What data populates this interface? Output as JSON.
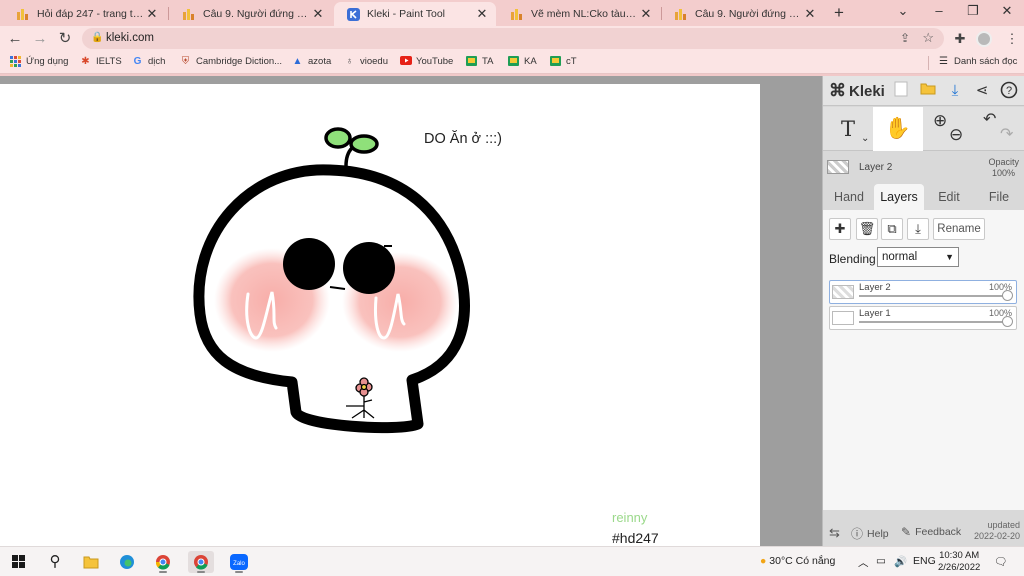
{
  "browser": {
    "tabs": [
      {
        "title": "Hỏi đáp 247 - trang tra loi",
        "icon": "hoidap-favicon",
        "active": false
      },
      {
        "title": "Câu 9. Người đứng đầu một",
        "icon": "hoidap-favicon",
        "active": false
      },
      {
        "title": "Kleki - Paint Tool",
        "icon": "kleki-favicon",
        "active": true
      },
      {
        "title": "Vẽ mèm NL:Cko tàu hỏi cái",
        "icon": "hoidap-favicon",
        "active": false
      },
      {
        "title": "Câu 9. Người đứng đầu một",
        "icon": "hoidap-favicon",
        "active": false
      }
    ],
    "new_tab": "+",
    "url": "kleki.com",
    "bookmarks": [
      {
        "label": "Ứng dụng",
        "icon": "apps-grid-icon"
      },
      {
        "label": "IELTS",
        "icon": "ielts-icon"
      },
      {
        "label": "dịch",
        "icon": "google-icon"
      },
      {
        "label": "Cambridge Diction...",
        "icon": "cambridge-icon"
      },
      {
        "label": "azota",
        "icon": "azota-icon"
      },
      {
        "label": "vioedu",
        "icon": "vioedu-icon"
      },
      {
        "label": "YouTube",
        "icon": "youtube-icon"
      },
      {
        "label": "TA",
        "icon": "classroom-icon"
      },
      {
        "label": "KA",
        "icon": "classroom-icon"
      },
      {
        "label": "cT",
        "icon": "classroom-icon"
      }
    ],
    "reading_list": "Danh sách đọc",
    "colors": {
      "tabstrip": "#f3cdcd",
      "toolbar": "#fbe4e4"
    }
  },
  "canvas": {
    "caption": "DO Ăn ở :::)",
    "watermark_name": "reinny",
    "watermark_tag": "#hd247",
    "colors": {
      "sprout": "#8fe07a",
      "blush": "#f7a9a4",
      "outline": "#000000",
      "flower": "#e79090"
    }
  },
  "panel": {
    "brand": "Kleki",
    "tool_text": "T",
    "layer_name": "Layer 2",
    "opacity_label": "Opacity",
    "opacity_value": "100%",
    "tabs": [
      "Hand",
      "Layers",
      "Edit",
      "File"
    ],
    "active_tab": "Layers",
    "rename": "Rename",
    "blending_label": "Blending",
    "blending_value": "normal",
    "layers": [
      {
        "name": "Layer 2",
        "opacity": "100%",
        "active": true
      },
      {
        "name": "Layer 1",
        "opacity": "100%",
        "active": false
      }
    ],
    "help": "Help",
    "feedback": "Feedback",
    "updated_label": "updated",
    "updated_date": "2022-02-20"
  },
  "taskbar": {
    "weather": "30°C  Có nắng",
    "language": "ENG",
    "time": "10:30 AM",
    "date": "2/26/2022"
  }
}
